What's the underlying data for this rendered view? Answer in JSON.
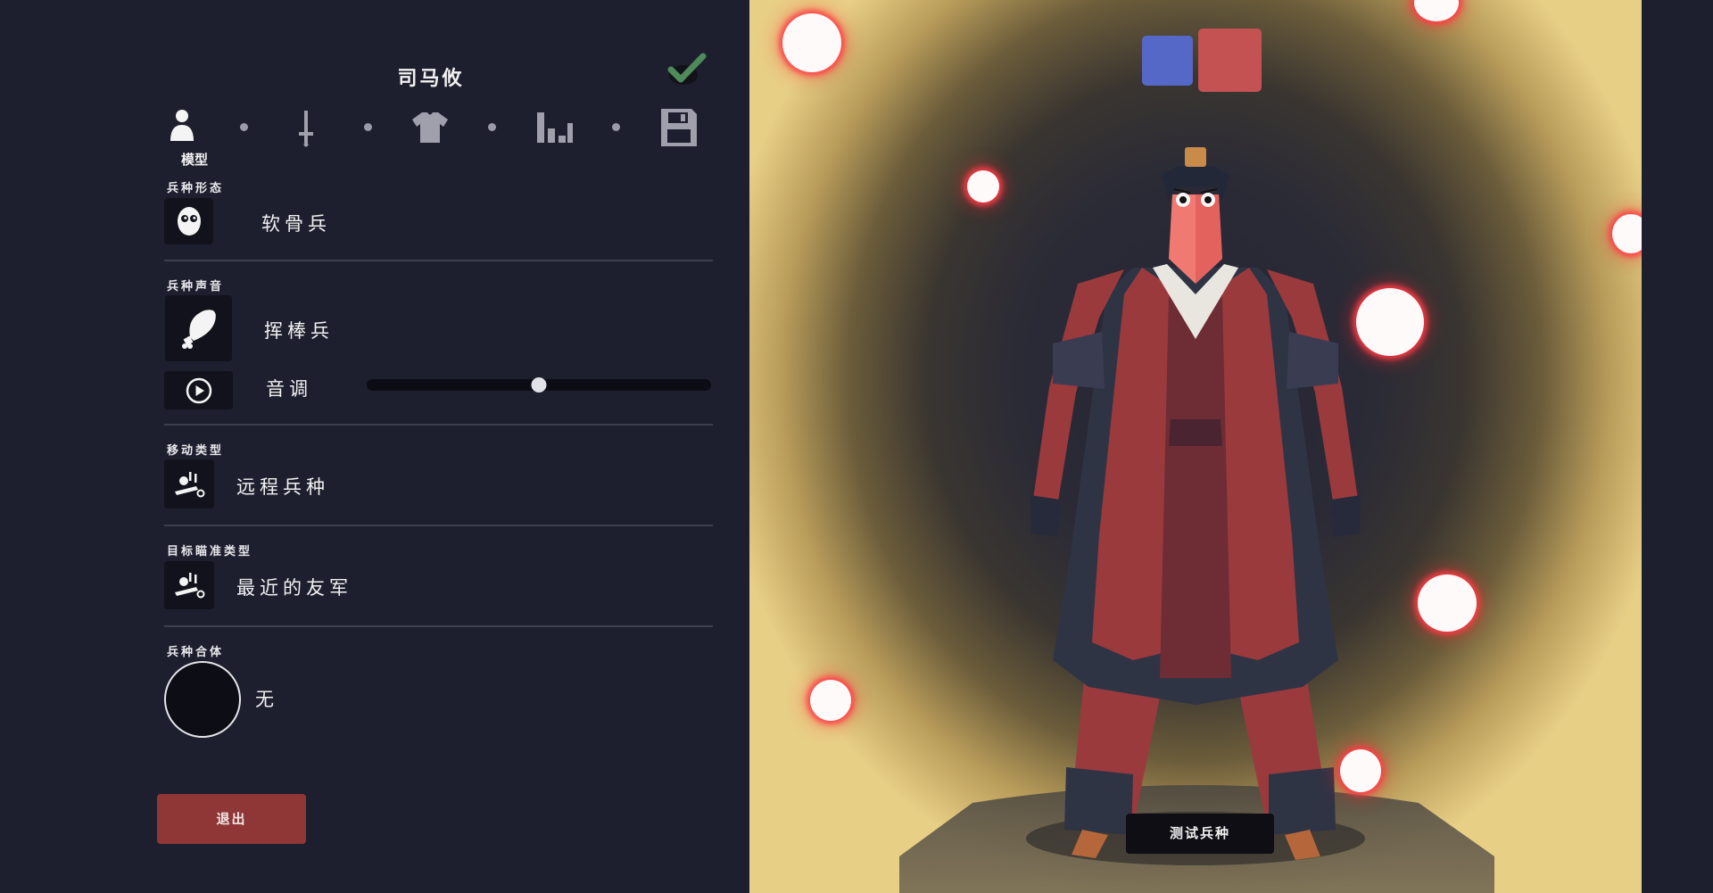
{
  "editor": {
    "unit_name": "司马攸",
    "steps": [
      {
        "icon": "person-icon",
        "label": "模型",
        "active": true
      },
      {
        "icon": "sword-icon",
        "active": false
      },
      {
        "icon": "shirt-icon",
        "active": false
      },
      {
        "icon": "stats-icon",
        "active": false
      },
      {
        "icon": "save-icon",
        "active": false
      }
    ],
    "sections": {
      "form": {
        "label": "兵种形态",
        "value": "软骨兵",
        "icon": "ragdoll-face-icon"
      },
      "voice": {
        "label": "兵种声音",
        "value": "挥棒兵",
        "icon": "drumstick-icon",
        "pitch_label": "音调",
        "pitch_value": 0.5,
        "play_icon": "play-icon"
      },
      "movement": {
        "label": "移动类型",
        "value": "远程兵种",
        "icon": "movement-icon"
      },
      "target": {
        "label": "目标瞄准类型",
        "value": "最近的友军",
        "icon": "target-icon"
      },
      "combine": {
        "label": "兵种合体",
        "value": "无"
      }
    },
    "exit_label": "退出"
  },
  "preview": {
    "team_colors": [
      "#5568c8",
      "#c45252"
    ],
    "test_label": "测试兵种"
  }
}
